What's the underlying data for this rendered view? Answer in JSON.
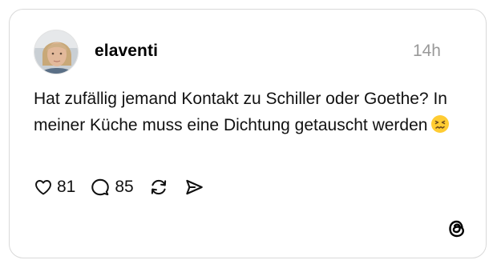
{
  "post": {
    "username": "elaventi",
    "timestamp": "14h",
    "text": "Hat zufällig jemand Kontakt zu Schiller oder Goethe? In meiner Küche muss eine Dichtung getauscht werden",
    "emoji": "confounded-face",
    "likes": "81",
    "replies": "85"
  },
  "icons": {
    "like": "heart-icon",
    "reply": "comment-icon",
    "repost": "repost-icon",
    "share": "send-icon",
    "brand": "threads-logo"
  },
  "colors": {
    "border": "#d9d9d9",
    "timestamp": "#999999",
    "emoji": "#ffcc33"
  }
}
